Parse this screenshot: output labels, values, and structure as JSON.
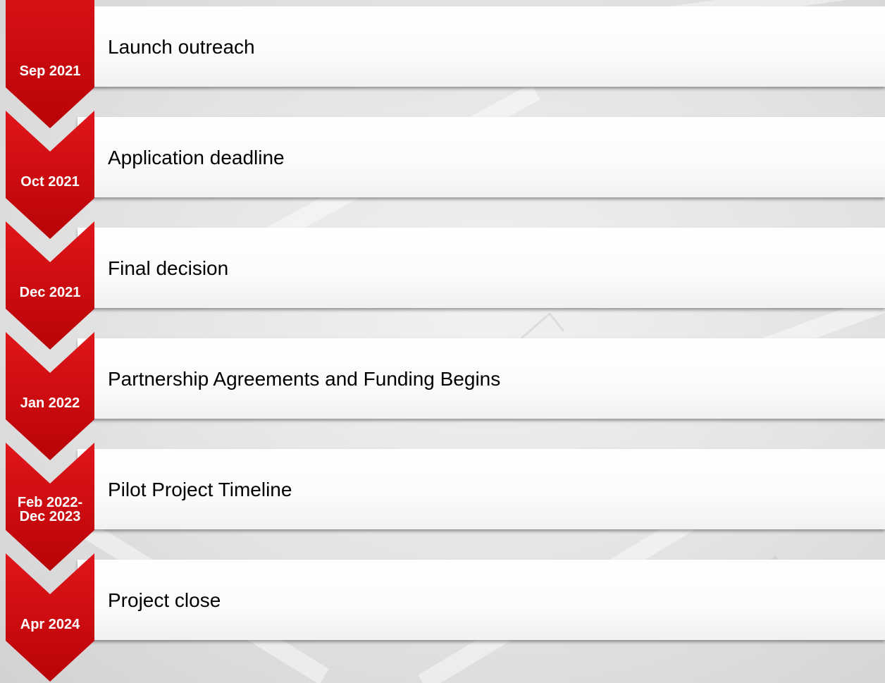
{
  "timeline": {
    "steps": [
      {
        "date": "Sep 2021",
        "label": "Launch outreach"
      },
      {
        "date": "Oct 2021",
        "label": "Application deadline"
      },
      {
        "date": "Dec 2021",
        "label": "Final decision"
      },
      {
        "date": "Jan 2022",
        "label": "Partnership Agreements and Funding Begins"
      },
      {
        "date": "Feb 2022-\nDec 2023",
        "label": "Pilot Project Timeline"
      },
      {
        "date": "Apr 2024",
        "label": "Project close"
      }
    ]
  },
  "colors": {
    "chevron_red": "#c8080d",
    "chevron_red_dark": "#a40004",
    "bar_fill": "#ffffff",
    "background": "#e3e3e3"
  }
}
